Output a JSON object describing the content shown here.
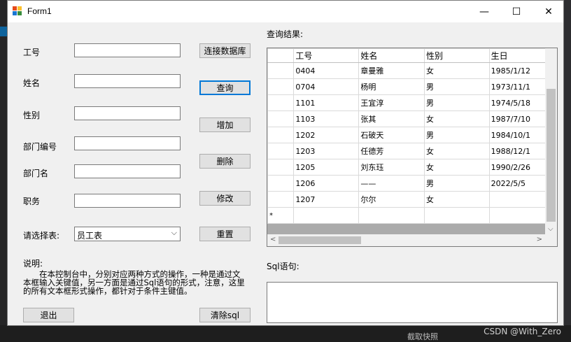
{
  "window": {
    "title": "Form1",
    "minimize_glyph": "—",
    "maximize_glyph": "☐",
    "close_glyph": "✕"
  },
  "fields": {
    "emp_id_label": "工号",
    "name_label": "姓名",
    "gender_label": "性别",
    "dept_id_label": "部门编号",
    "dept_name_label": "部门名",
    "position_label": "职务",
    "table_select_label": "请选择表:",
    "table_select_value": "员工表"
  },
  "buttons": {
    "connect": "连接数据库",
    "query": "查询",
    "add": "增加",
    "delete": "删除",
    "modify": "修改",
    "reset": "重置",
    "exit": "退出",
    "clear_sql": "清除sql"
  },
  "note": {
    "title": "说明:",
    "body": "在本控制台中，分别对应两种方式的操作，一种是通过文本框输入关键值，另一方面是通过Sql语句的形式，注意，这里的所有文本框形式操作，都针对于条件主键值。"
  },
  "results": {
    "label": "查询结果:",
    "columns": [
      "工号",
      "姓名",
      "性别",
      "生日"
    ],
    "rows": [
      [
        "0404",
        "章曼雅",
        "女",
        "1985/1/12"
      ],
      [
        "0704",
        "杨明",
        "男",
        "1973/11/1"
      ],
      [
        "1101",
        "王宜淳",
        "男",
        "1974/5/18"
      ],
      [
        "1103",
        "张其",
        "女",
        "1987/7/10"
      ],
      [
        "1202",
        "石破天",
        "男",
        "1984/10/1"
      ],
      [
        "1203",
        "任德芳",
        "女",
        "1988/12/1"
      ],
      [
        "1205",
        "刘东珏",
        "女",
        "1990/2/26"
      ],
      [
        "1206",
        "——",
        "男",
        "2022/5/5"
      ],
      [
        "1207",
        "尔尔",
        "女",
        ""
      ]
    ],
    "new_row_marker": "*"
  },
  "sql": {
    "label": "Sql语句:",
    "value": ""
  },
  "background": {
    "watermark": "CSDN @With_Zero",
    "bottom_text": "截取快照"
  }
}
